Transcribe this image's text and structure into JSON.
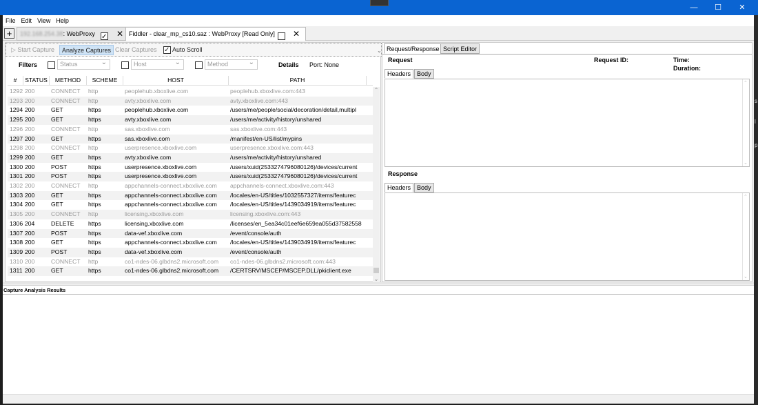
{
  "menu": [
    "File",
    "Edit",
    "View",
    "Help"
  ],
  "sessions": {
    "tab1": {
      "blurred_ip": "192.168.254.38",
      "label": ": WebProxy"
    },
    "tab2": {
      "label": "Fiddler - clear_mp_cs10.saz : WebProxy [Read Only]"
    }
  },
  "toolbar": {
    "start": "Start Capture",
    "analyze": "Analyze Captures",
    "clear": "Clear Captures",
    "autoscroll": "Auto Scroll"
  },
  "filters": {
    "label": "Filters",
    "status_placeholder": "Status",
    "host_placeholder": "Host",
    "method_placeholder": "Method",
    "details": "Details",
    "port": "Port: None"
  },
  "table": {
    "headers": [
      "#",
      "STATUS",
      "METHOD",
      "SCHEME",
      "HOST",
      "PATH"
    ],
    "rows": [
      {
        "num": "1292",
        "status": "200",
        "method": "CONNECT",
        "scheme": "http",
        "host": "peoplehub.xboxlive.com",
        "path": "peoplehub.xboxlive.com:443",
        "dim": true
      },
      {
        "num": "1293",
        "status": "200",
        "method": "CONNECT",
        "scheme": "http",
        "host": "avty.xboxlive.com",
        "path": "avty.xboxlive.com:443",
        "dim": true
      },
      {
        "num": "1294",
        "status": "200",
        "method": "GET",
        "scheme": "https",
        "host": "peoplehub.xboxlive.com",
        "path": "/users/me/people/social/decoration/detail,multipl",
        "dim": false
      },
      {
        "num": "1295",
        "status": "200",
        "method": "GET",
        "scheme": "https",
        "host": "avty.xboxlive.com",
        "path": "/users/me/activity/history/unshared",
        "dim": false
      },
      {
        "num": "1296",
        "status": "200",
        "method": "CONNECT",
        "scheme": "http",
        "host": "sas.xboxlive.com",
        "path": "sas.xboxlive.com:443",
        "dim": true
      },
      {
        "num": "1297",
        "status": "200",
        "method": "GET",
        "scheme": "https",
        "host": "sas.xboxlive.com",
        "path": "/manifest/en-US/list/mypins",
        "dim": false
      },
      {
        "num": "1298",
        "status": "200",
        "method": "CONNECT",
        "scheme": "http",
        "host": "userpresence.xboxlive.com",
        "path": "userpresence.xboxlive.com:443",
        "dim": true
      },
      {
        "num": "1299",
        "status": "200",
        "method": "GET",
        "scheme": "https",
        "host": "avty.xboxlive.com",
        "path": "/users/me/activity/history/unshared",
        "dim": false
      },
      {
        "num": "1300",
        "status": "200",
        "method": "POST",
        "scheme": "https",
        "host": "userpresence.xboxlive.com",
        "path": "/users/xuid(2533274796080126)/devices/current",
        "dim": false
      },
      {
        "num": "1301",
        "status": "200",
        "method": "POST",
        "scheme": "https",
        "host": "userpresence.xboxlive.com",
        "path": "/users/xuid(2533274796080126)/devices/current",
        "dim": false
      },
      {
        "num": "1302",
        "status": "200",
        "method": "CONNECT",
        "scheme": "http",
        "host": "appchannels-connect.xboxlive.com",
        "path": "appchannels-connect.xboxlive.com:443",
        "dim": true
      },
      {
        "num": "1303",
        "status": "200",
        "method": "GET",
        "scheme": "https",
        "host": "appchannels-connect.xboxlive.com",
        "path": "/locales/en-US/titles/1032557327/items/featurec",
        "dim": false
      },
      {
        "num": "1304",
        "status": "200",
        "method": "GET",
        "scheme": "https",
        "host": "appchannels-connect.xboxlive.com",
        "path": "/locales/en-US/titles/1439034919/items/featurec",
        "dim": false
      },
      {
        "num": "1305",
        "status": "200",
        "method": "CONNECT",
        "scheme": "http",
        "host": "licensing.xboxlive.com",
        "path": "licensing.xboxlive.com:443",
        "dim": true
      },
      {
        "num": "1306",
        "status": "204",
        "method": "DELETE",
        "scheme": "https",
        "host": "licensing.xboxlive.com",
        "path": "/licenses/en_5ea34c01eef6e659ea055d37582558",
        "dim": false
      },
      {
        "num": "1307",
        "status": "200",
        "method": "POST",
        "scheme": "https",
        "host": "data-vef.xboxlive.com",
        "path": "/event/console/auth",
        "dim": false
      },
      {
        "num": "1308",
        "status": "200",
        "method": "GET",
        "scheme": "https",
        "host": "appchannels-connect.xboxlive.com",
        "path": "/locales/en-US/titles/1439034919/items/featurec",
        "dim": false
      },
      {
        "num": "1309",
        "status": "200",
        "method": "POST",
        "scheme": "https",
        "host": "data-vef.xboxlive.com",
        "path": "/event/console/auth",
        "dim": false
      },
      {
        "num": "1310",
        "status": "200",
        "method": "CONNECT",
        "scheme": "http",
        "host": "co1-ndes-06.glbdns2.microsoft.com",
        "path": "co1-ndes-06.glbdns2.microsoft.com:443",
        "dim": true
      },
      {
        "num": "1311",
        "status": "200",
        "method": "GET",
        "scheme": "https",
        "host": "co1-ndes-06.glbdns2.microsoft.com",
        "path": "/CERTSRV/MSCEP/MSCEP.DLL/pkiclient.exe",
        "dim": false
      }
    ]
  },
  "right": {
    "tabs": [
      "Request/Response",
      "Script Editor"
    ],
    "request": "Request",
    "request_id": "Request ID:",
    "time": "Time:",
    "duration": "Duration:",
    "response": "Response",
    "subtabs": [
      "Headers",
      "Body"
    ]
  },
  "results": {
    "title": "Capture Analysis Results"
  }
}
